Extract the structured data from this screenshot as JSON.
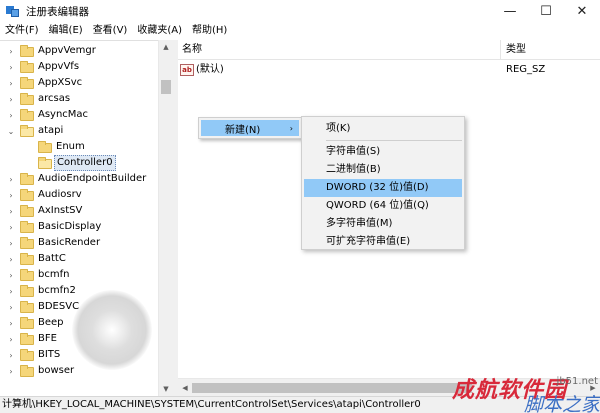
{
  "window": {
    "title": "注册表编辑器",
    "buttons": {
      "minimize": "—",
      "maximize": "☐",
      "close": "✕"
    }
  },
  "menubar": [
    "文件(F)",
    "编辑(E)",
    "查看(V)",
    "收藏夹(A)",
    "帮助(H)"
  ],
  "tree": {
    "items": [
      {
        "label": "AppvVemgr",
        "expander": "›"
      },
      {
        "label": "AppvVfs",
        "expander": "›"
      },
      {
        "label": "AppXSvc",
        "expander": "›"
      },
      {
        "label": "arcsas",
        "expander": "›"
      },
      {
        "label": "AsyncMac",
        "expander": "›"
      },
      {
        "label": "atapi",
        "expander": "⌄"
      },
      {
        "label": "Enum",
        "expander": ""
      },
      {
        "label": "Controller0",
        "expander": ""
      },
      {
        "label": "AudioEndpointBuilder",
        "expander": "›"
      },
      {
        "label": "Audiosrv",
        "expander": "›"
      },
      {
        "label": "AxInstSV",
        "expander": "›"
      },
      {
        "label": "BasicDisplay",
        "expander": "›"
      },
      {
        "label": "BasicRender",
        "expander": "›"
      },
      {
        "label": "BattC",
        "expander": "›"
      },
      {
        "label": "bcmfn",
        "expander": "›"
      },
      {
        "label": "bcmfn2",
        "expander": "›"
      },
      {
        "label": "BDESVC",
        "expander": "›"
      },
      {
        "label": "Beep",
        "expander": "›"
      },
      {
        "label": "BFE",
        "expander": "›"
      },
      {
        "label": "BITS",
        "expander": "›"
      },
      {
        "label": "bowser",
        "expander": "›"
      }
    ],
    "selected": "Controller0"
  },
  "list": {
    "columns": [
      "名称",
      "类型"
    ],
    "rows": [
      {
        "icon": "ab",
        "name": "(默认)",
        "type": "REG_SZ"
      }
    ]
  },
  "context_menu": {
    "new_label": "新建(N)",
    "arrow": "›",
    "submenu": [
      "项(K)",
      "字符串值(S)",
      "二进制值(B)",
      "DWORD (32 位)值(D)",
      "QWORD (64 位)值(Q)",
      "多字符串值(M)",
      "可扩充字符串值(E)"
    ],
    "highlighted_index": 3
  },
  "status_bar": "计算机\\HKEY_LOCAL_MACHINE\\SYSTEM\\CurrentControlSet\\Services\\atapi\\Controller0",
  "watermark": {
    "brand_cn": "成航软件园",
    "site": "jb51.net",
    "brand_tail": "脚本之家"
  },
  "colors": {
    "highlight": "#91c9f7",
    "folder": "#f5d67a",
    "menu_bg": "#f2f2f2",
    "brand_red": "#d8293a",
    "brand_blue": "#3c6fc4"
  }
}
